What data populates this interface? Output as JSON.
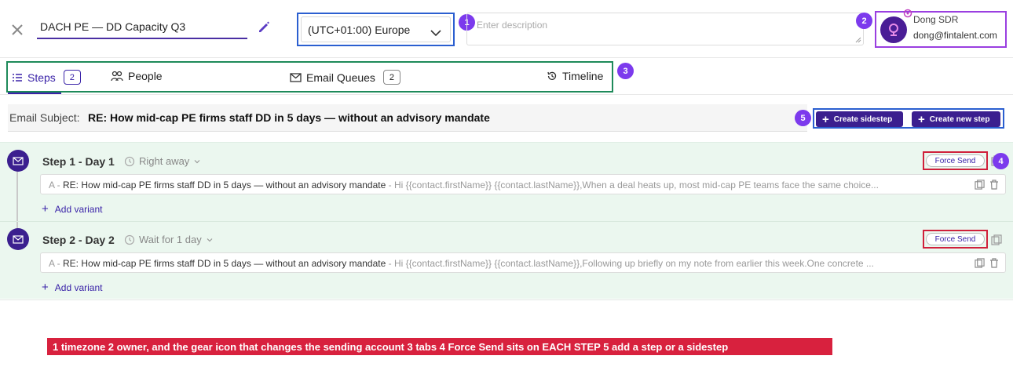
{
  "header": {
    "title": "DACH PE — DD Capacity Q3",
    "timezone": "(UTC+01:00) Europe",
    "description_placeholder": "Enter description",
    "owner_name": "Dong SDR",
    "owner_email": "dong@fintalent.com"
  },
  "callouts": [
    "1",
    "2",
    "3",
    "4",
    "5"
  ],
  "tabs": [
    {
      "label": "Steps",
      "count": "2"
    },
    {
      "label": "People"
    },
    {
      "label": "Email Queues",
      "count": "2"
    },
    {
      "label": "Timeline"
    }
  ],
  "subject": {
    "label": "Email Subject:",
    "value": "RE: How mid-cap PE firms staff DD in 5 days — without an advisory mandate"
  },
  "actions": {
    "create_sidestep": "Create sidestep",
    "create_new_step": "Create new step"
  },
  "steps": [
    {
      "title": "Step 1 - Day 1",
      "timing": "Right away",
      "force_send": "Force Send",
      "variant_prefix": "A - ",
      "variant_subject": "RE: How mid-cap PE firms staff DD in 5 days — without an advisory mandate",
      "variant_body": " - Hi {{contact.firstName}} {{contact.lastName}},When a deal heats up, most mid-cap PE teams face the same choice...",
      "add_variant": "Add variant"
    },
    {
      "title": "Step 2 - Day 2",
      "timing": "Wait for 1 day",
      "force_send": "Force Send",
      "variant_prefix": "A - ",
      "variant_subject": "RE: How mid-cap PE firms staff DD in 5 days — without an advisory mandate",
      "variant_body": " - Hi {{contact.firstName}} {{contact.lastName}},Following up briefly on my note from earlier this week.One concrete ...",
      "add_variant": "Add variant"
    }
  ],
  "legend": "1 timezone   2 owner, and the gear icon that changes the sending account   3 tabs   4 Force Send sits on EACH STEP   5 add a step or a sidestep",
  "colors": {
    "brand_purple": "#3b1f8f",
    "timezone_outline": "#2b5fd0",
    "owner_outline": "#9a3fe0",
    "tabs_outline": "#1e8a5a",
    "force_outline": "#d0203b",
    "legend_bg": "#d8213e",
    "steps_bg": "#ebf7ef"
  }
}
